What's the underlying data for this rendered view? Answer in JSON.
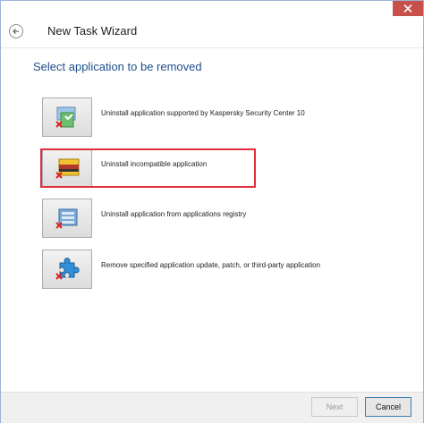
{
  "window": {
    "title": "New Task Wizard",
    "back_icon": "back-arrow-icon",
    "close_icon": "close-icon"
  },
  "heading": "Select application to be removed",
  "options": [
    {
      "label": "Uninstall application supported by Kaspersky Security Center 10",
      "icon": "uninstall-managed-app-icon",
      "selected": false
    },
    {
      "label": "Uninstall incompatible application",
      "icon": "uninstall-incompatible-app-icon",
      "selected": true
    },
    {
      "label": "Uninstall application from applications registry",
      "icon": "uninstall-registry-app-icon",
      "selected": false
    },
    {
      "label": "Remove specified application update, patch, or third-party application",
      "icon": "remove-update-patch-icon",
      "selected": false
    }
  ],
  "footer": {
    "next_label": "Next",
    "cancel_label": "Cancel"
  },
  "colors": {
    "heading": "#1f4e8c",
    "highlight": "#e0303a",
    "close": "#c7504b"
  }
}
